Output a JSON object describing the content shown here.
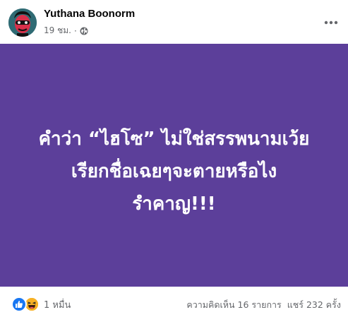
{
  "post": {
    "author": "Yuthana Boonorm",
    "time": "19 ชม.",
    "separator": "·",
    "privacy_icon": "globe-icon",
    "more_icon": "more-horizontal-icon"
  },
  "banner": {
    "background": "#5c3f9a",
    "text_color": "#ffffff",
    "lines": [
      "คำว่า “ไฮโซ” ไม่ใช่สรรพนามเว้ย",
      "เรียกชื่อเฉยๆจะตายหรือไง",
      "รำคาญ!!!"
    ]
  },
  "footer": {
    "reaction_icons": [
      "like-icon",
      "haha-icon"
    ],
    "reaction_count": "1 หมื่น",
    "comments": "ความคิดเห็น 16 รายการ",
    "shares": "แชร์ 232 ครั้ง"
  },
  "colors": {
    "like": "#1877f2",
    "haha": "#f7b125",
    "secondary_text": "#65676b"
  }
}
